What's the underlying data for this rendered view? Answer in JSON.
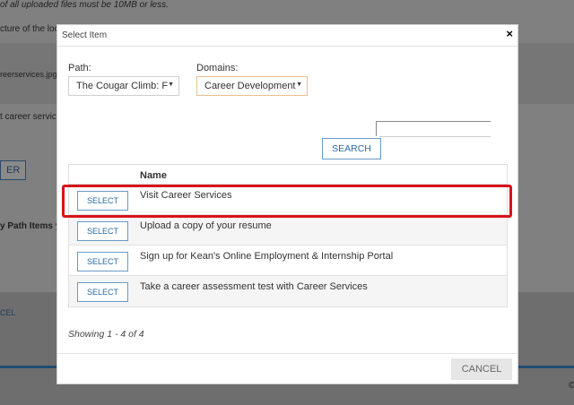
{
  "background": {
    "note_text": "of all uploaded files must be 10MB or less.",
    "structure_text": "cture of the loc",
    "file_text": "reerservices.jpg",
    "career_text": "t career servic",
    "button_fragment": "ER",
    "path_items_text": "y Path Items y",
    "cancel_fragment": "CEL",
    "copyright_fragment": "©"
  },
  "modal": {
    "title": "Select Item",
    "close_glyph": "×"
  },
  "filters": {
    "path_label": "Path:",
    "path_value": "The Cougar Climb: F",
    "domains_label": "Domains:",
    "domains_value": "Career Development",
    "caret_glyph": "▼"
  },
  "search": {
    "button_label": "SEARCH"
  },
  "table": {
    "name_header": "Name",
    "select_label": "SELECT",
    "rows": [
      {
        "name": "Visit Career Services"
      },
      {
        "name": "Upload a copy of your resume"
      },
      {
        "name": "Sign up for Kean's Online Employment & Internship Portal"
      },
      {
        "name": "Take a career assessment test with Career Services"
      }
    ]
  },
  "footer": {
    "showing_text": "Showing 1 - 4 of 4",
    "cancel_label": "CANCEL"
  },
  "colors": {
    "accent_blue": "#2a6aa6",
    "highlight_red": "#d7141a",
    "domain_border": "#e8c08c"
  }
}
